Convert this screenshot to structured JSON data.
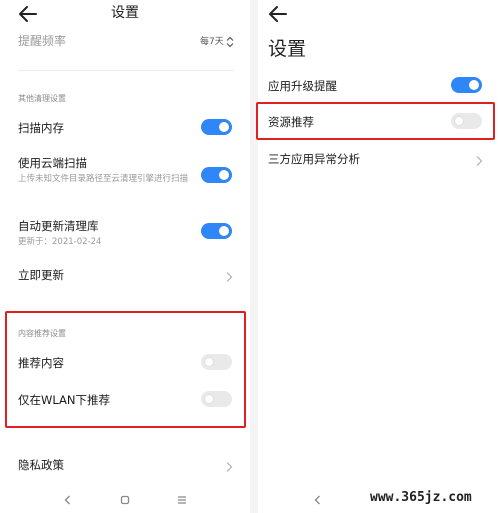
{
  "left": {
    "title": "设置",
    "reminder_frequency": {
      "label": "提醒频率",
      "value": "每7天"
    },
    "other_cleanup": {
      "section": "其他清理设置",
      "scan_memory": {
        "label": "扫描内存",
        "enabled": true
      },
      "cloud_scan": {
        "label": "使用云端扫描",
        "sub": "上传未知文件目录路径至云清理引擎进行扫描",
        "enabled": true
      },
      "auto_update": {
        "label": "自动更新清理库",
        "sub": "更新于：2021-02-24",
        "enabled": true
      },
      "update_now": {
        "label": "立即更新"
      }
    },
    "content_recommend": {
      "section": "内容推荐设置",
      "recommend_content": {
        "label": "推荐内容",
        "enabled": false
      },
      "wlan_only": {
        "label": "仅在WLAN下推荐",
        "enabled": false
      }
    },
    "privacy": {
      "label": "隐私政策"
    }
  },
  "right": {
    "title": "设置",
    "app_upgrade": {
      "label": "应用升级提醒",
      "enabled": true
    },
    "resource_recommend": {
      "label": "资源推荐",
      "enabled": false
    },
    "third_party": {
      "label": "三方应用异常分析"
    }
  },
  "watermark": "www.365jz.com",
  "colors": {
    "accent": "#2f86f6",
    "highlight": "#e02020"
  }
}
